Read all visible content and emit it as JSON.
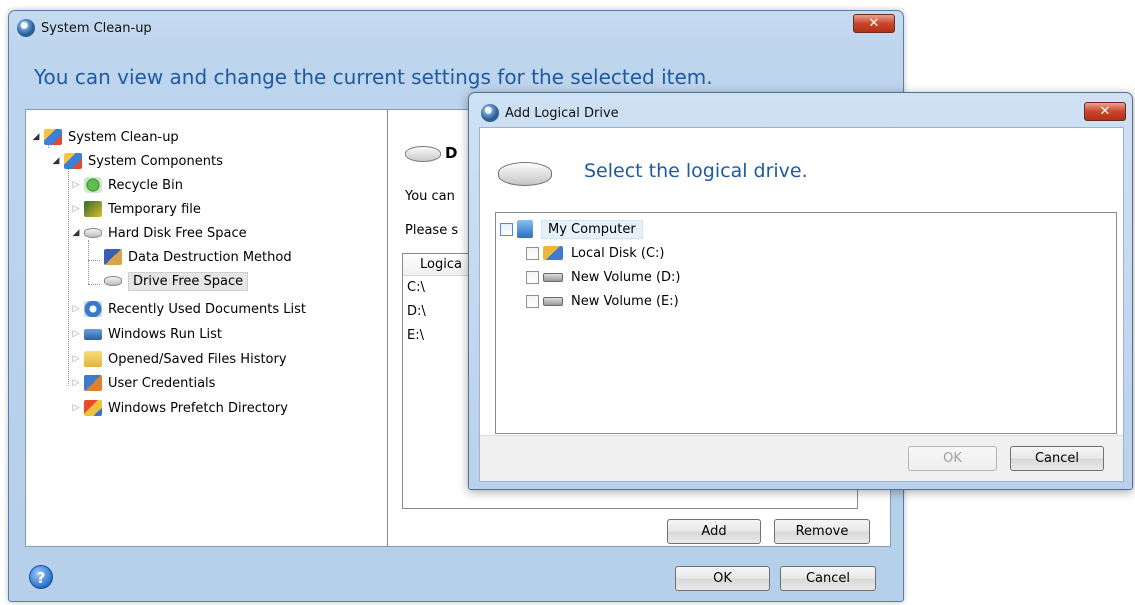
{
  "main_window": {
    "title": "System Clean-up",
    "close_label": "✕",
    "headline": "You can view and change the current settings for the selected item.",
    "tree": [
      {
        "label": "System Clean-up",
        "icon": "system-cleanup-icon"
      },
      {
        "label": "System Components",
        "icon": "system-components-icon"
      },
      {
        "label": "Recycle Bin",
        "icon": "recycle-bin-icon"
      },
      {
        "label": "Temporary file",
        "icon": "temporary-file-icon"
      },
      {
        "label": "Hard Disk Free Space",
        "icon": "hard-disk-icon"
      },
      {
        "label": "Data Destruction Method",
        "icon": "data-destruction-icon"
      },
      {
        "label": "Drive Free Space",
        "icon": "drive-icon",
        "selected": true
      },
      {
        "label": "Recently Used Documents List",
        "icon": "recent-documents-icon"
      },
      {
        "label": "Windows Run List",
        "icon": "run-list-icon"
      },
      {
        "label": "Opened/Saved Files History",
        "icon": "folder-icon"
      },
      {
        "label": "User Credentials",
        "icon": "user-credentials-icon"
      },
      {
        "label": "Windows Prefetch Directory",
        "icon": "prefetch-icon"
      }
    ],
    "right_pane": {
      "heading_initial": "D",
      "text_1": "You can",
      "text_2": "Please s",
      "list_header": "Logica",
      "drives": [
        "C:\\",
        "D:\\",
        "E:\\"
      ],
      "add_label": "Add",
      "remove_label": "Remove"
    },
    "help_label": "?",
    "ok_label": "OK",
    "cancel_label": "Cancel"
  },
  "dialog": {
    "title": "Add Logical Drive",
    "close_label": "✕",
    "heading": "Select the logical drive.",
    "tree": {
      "root": "My Computer",
      "items": [
        "Local Disk (C:)",
        "New Volume (D:)",
        "New Volume (E:)"
      ]
    },
    "ok_label": "OK",
    "cancel_label": "Cancel"
  }
}
